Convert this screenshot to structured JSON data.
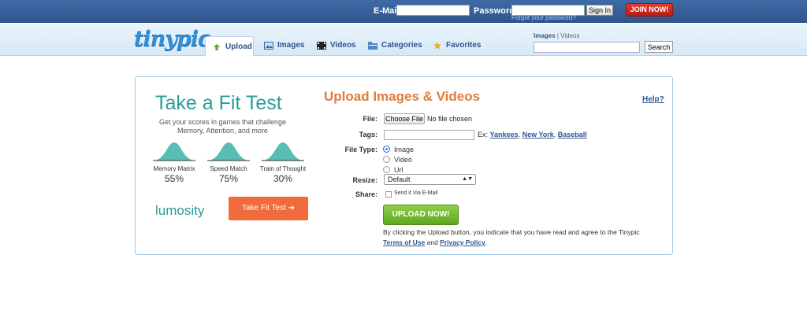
{
  "topbar": {
    "email_label": "E-Mail:",
    "password_label": "Password:",
    "forgot_link": "Forgot your password?",
    "signin_label": "Sign In",
    "join_label": "JOIN NOW!"
  },
  "header": {
    "logo": "tinypic",
    "tabs": [
      {
        "label": "Upload",
        "icon": "upload-arrow-icon",
        "active": true
      },
      {
        "label": "Images",
        "icon": "images-icon"
      },
      {
        "label": "Videos",
        "icon": "film-icon"
      },
      {
        "label": "Categories",
        "icon": "folder-icon"
      },
      {
        "label": "Favorites",
        "icon": "star-icon"
      }
    ],
    "search_tab_images": "Images",
    "search_tab_sep": "|",
    "search_tab_videos": "Videos",
    "search_button": "Search"
  },
  "ad": {
    "title": "Take a Fit Test",
    "subtitle": "Get your scores in games that challenge Memory, Attention, and more",
    "games": [
      {
        "label": "Memory Matrix",
        "percent": "55%"
      },
      {
        "label": "Speed Match",
        "percent": "75%"
      },
      {
        "label": "Train of Thought",
        "percent": "30%"
      }
    ],
    "brand": "lumosity",
    "button": "Take Fit Test ➔",
    "accent": "#2a9d9a",
    "button_color": "#f26b3a"
  },
  "upload": {
    "title": "Upload Images & Videos",
    "help": "Help?",
    "file_label": "File:",
    "choose_file": "Choose File",
    "no_file": "No file chosen",
    "tags_label": "Tags:",
    "tags_value": "",
    "examples_prefix": "Ex:",
    "examples": [
      "Yankees",
      "New York",
      "Baseball"
    ],
    "file_type_label": "File Type:",
    "file_types": [
      "Image",
      "Video",
      "Url"
    ],
    "file_type_selected": "Image",
    "resize_label": "Resize:",
    "resize_value": "Default",
    "share_label": "Share:",
    "share_option": "Send it Via E-Mail",
    "upload_button": "UPLOAD NOW!",
    "legal_text": "By clicking the Upload button, you indicate that you have read and agree to the Tinypic",
    "terms_link": "Terms of Use",
    "and_text": "and",
    "privacy_link": "Privacy Policy",
    "period": "."
  }
}
